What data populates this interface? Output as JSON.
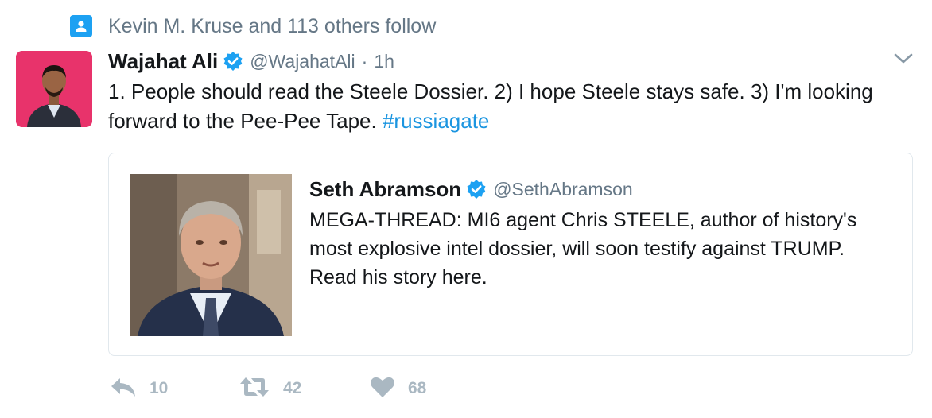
{
  "social_context": {
    "icon": "person-icon",
    "text": "Kevin M. Kruse and 113 others follow"
  },
  "tweet": {
    "author_name": "Wajahat Ali",
    "author_handle": "@WajahatAli",
    "separator": "·",
    "time": "1h",
    "text_main": "1. People should read the Steele Dossier. 2) I hope Steele stays safe. 3) I'm looking forward to the Pee-Pee Tape. ",
    "hashtag": "#russiagate"
  },
  "quoted_tweet": {
    "author_name": "Seth Abramson",
    "author_handle": "@SethAbramson",
    "text": "MEGA-THREAD: MI6 agent Chris STEELE, author of history's most explosive intel dossier, will soon testify against TRUMP. Read his story here."
  },
  "actions": {
    "reply_count": "10",
    "retweet_count": "42",
    "like_count": "68"
  },
  "colors": {
    "accent": "#1da1f2",
    "link": "#1b95e0",
    "muted": "#657786",
    "action_gray": "#aab8c2",
    "border": "#e1e8ed"
  }
}
